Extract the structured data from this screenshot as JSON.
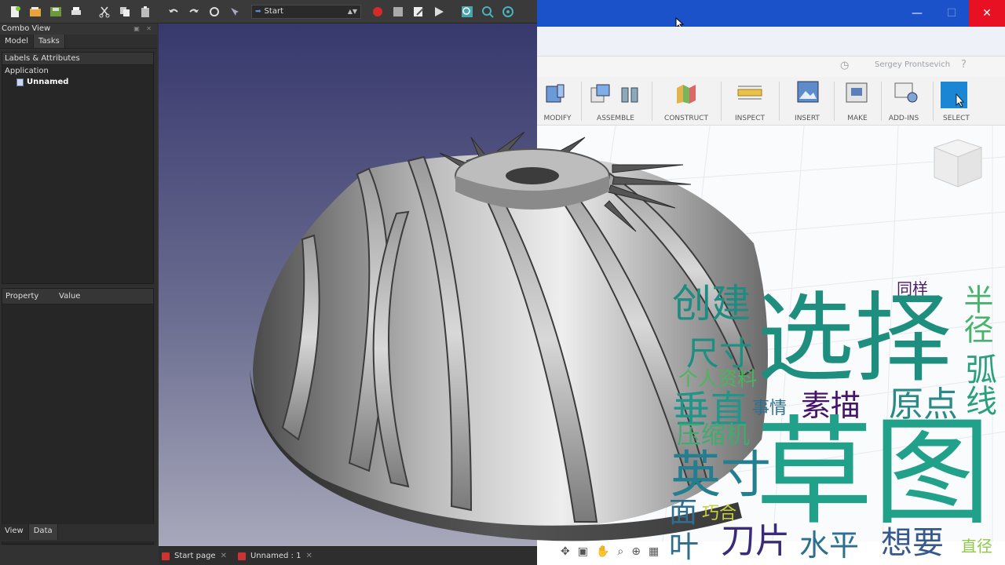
{
  "freecad": {
    "toolbar": {
      "workbench": "Start",
      "icons": [
        "new-file-icon",
        "open-icon",
        "save-icon",
        "print-icon",
        "cut-icon",
        "copy-icon",
        "paste-icon",
        "undo-icon",
        "redo-icon",
        "refresh-icon",
        "whats-this-icon",
        "record-macro-icon",
        "stop-macro-icon",
        "edit-macro-icon",
        "run-macro-icon",
        "fit-all-icon",
        "zoom-icon",
        "view-icon"
      ]
    },
    "combo_view": {
      "title": "Combo View",
      "tabs": [
        "Model",
        "Tasks"
      ],
      "tree_header": "Labels & Attributes",
      "application_label": "Application",
      "document": "Unnamed",
      "property_col": "Property",
      "value_col": "Value",
      "bottom_tabs": [
        "View",
        "Data"
      ]
    },
    "doc_tabs": [
      {
        "label": "Start page"
      },
      {
        "label": "Unnamed : 1"
      }
    ]
  },
  "fusion": {
    "titlebar_color": "#1b52c9",
    "window_controls": [
      "minimize-icon",
      "maximize-icon",
      "close-icon"
    ],
    "user": "Sergey Prontsevich",
    "ribbon": [
      "MODIFY",
      "ASSEMBLE",
      "CONSTRUCT",
      "INSPECT",
      "INSERT",
      "MAKE",
      "ADD-INS",
      "SELECT"
    ]
  },
  "word_cloud": [
    {
      "text": "选择",
      "color": "#1e8f7e"
    },
    {
      "text": "草图",
      "color": "#21a08a"
    },
    {
      "text": "创建",
      "color": "#1f8b81"
    },
    {
      "text": "同样",
      "color": "#4a1f66"
    },
    {
      "text": "半径",
      "color": "#48b36c"
    },
    {
      "text": "尺寸",
      "color": "#1d8f80"
    },
    {
      "text": "个人资料",
      "color": "#49b55e"
    },
    {
      "text": "弧线",
      "color": "#2aa07a"
    },
    {
      "text": "垂直",
      "color": "#22958a"
    },
    {
      "text": "事情",
      "color": "#2f6f8e"
    },
    {
      "text": "素描",
      "color": "#46136a"
    },
    {
      "text": "原点",
      "color": "#2a8a86"
    },
    {
      "text": "压缩机",
      "color": "#3fab6e"
    },
    {
      "text": "英寸",
      "color": "#237f8f"
    },
    {
      "text": "面",
      "color": "#2e6e90"
    },
    {
      "text": "巧合",
      "color": "#c8d23a"
    },
    {
      "text": "刀片",
      "color": "#3b2a78"
    },
    {
      "text": "水平",
      "color": "#2c6f8e"
    },
    {
      "text": "想要",
      "color": "#35588d"
    },
    {
      "text": "直径",
      "color": "#8fc94a"
    },
    {
      "text": "叶",
      "color": "#2f6d8f"
    }
  ]
}
